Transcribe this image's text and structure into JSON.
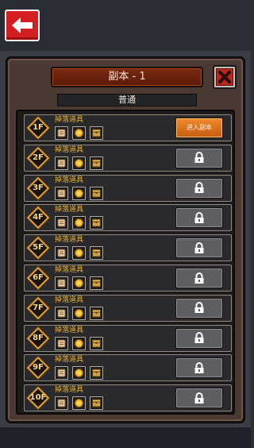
{
  "dialog": {
    "title": "副本 - 1",
    "subtitle": "普通",
    "drop_label": "掉落道具",
    "enter_label": "进入副本"
  },
  "icons": {
    "back": "back-arrow-icon",
    "close": "close-x-icon",
    "item1": "scroll-icon",
    "item2": "gold-coin-icon",
    "item3": "treasure-chest-icon",
    "locked": "lock-icon"
  },
  "colors": {
    "back_button": "#d41f22",
    "enter_button": "#e5781d",
    "drop_label": "#e5b33e",
    "floor_badge": "#e0a23a"
  },
  "floors": [
    {
      "label": "1F",
      "status": "unlocked"
    },
    {
      "label": "2F",
      "status": "locked"
    },
    {
      "label": "3F",
      "status": "locked"
    },
    {
      "label": "4F",
      "status": "locked"
    },
    {
      "label": "5F",
      "status": "locked"
    },
    {
      "label": "6F",
      "status": "locked"
    },
    {
      "label": "7F",
      "status": "locked"
    },
    {
      "label": "8F",
      "status": "locked"
    },
    {
      "label": "9F",
      "status": "locked"
    },
    {
      "label": "10F",
      "status": "locked"
    }
  ]
}
